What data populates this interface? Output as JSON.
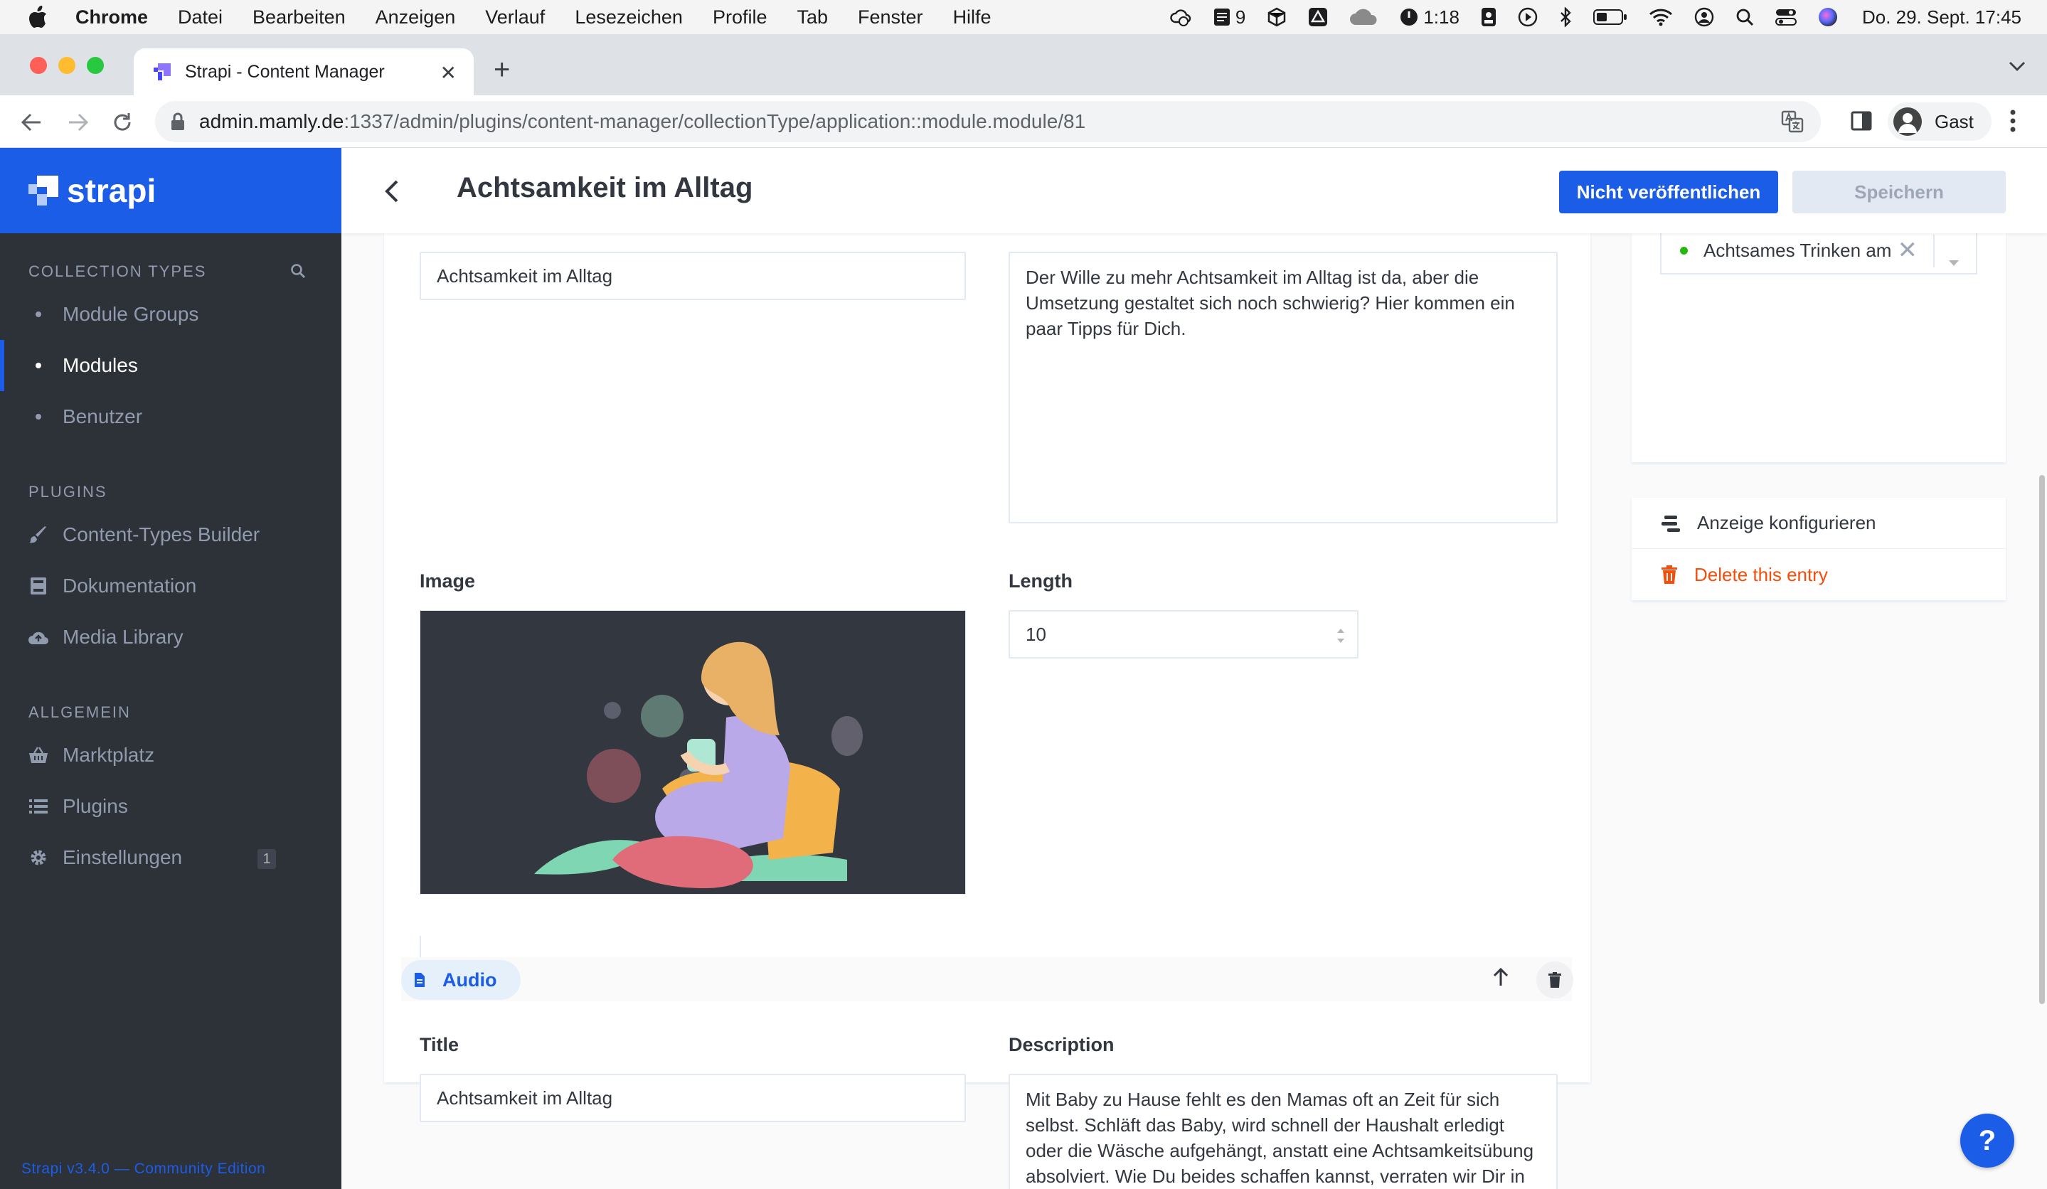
{
  "macos": {
    "app": "Chrome",
    "menu": [
      "Datei",
      "Bearbeiten",
      "Anzeigen",
      "Verlauf",
      "Lesezeichen",
      "Profile",
      "Tab",
      "Fenster",
      "Hilfe"
    ],
    "status_count": "9",
    "battery_time": "1:18",
    "clock": "Do. 29. Sept.  17:45"
  },
  "browser": {
    "tab_title": "Strapi - Content Manager",
    "url_host": "admin.mamly.de",
    "url_path": ":1337/admin/plugins/content-manager/collectionType/application::module.module/81",
    "profile": "Gast"
  },
  "sidebar": {
    "brand": "strapi",
    "collection_header": "COLLECTION TYPES",
    "collection_items": [
      {
        "label": "Module Groups"
      },
      {
        "label": "Modules"
      },
      {
        "label": "Benutzer"
      }
    ],
    "plugins_header": "PLUGINS",
    "plugins": [
      {
        "label": "Content-Types Builder",
        "icon": "paintbrush-icon"
      },
      {
        "label": "Dokumentation",
        "icon": "book-icon"
      },
      {
        "label": "Media Library",
        "icon": "cloud-upload-icon"
      }
    ],
    "general_header": "ALLGEMEIN",
    "general": [
      {
        "label": "Marktplatz",
        "icon": "basket-icon"
      },
      {
        "label": "Plugins",
        "icon": "list-icon"
      },
      {
        "label": "Einstellungen",
        "icon": "gear-icon",
        "badge": "1"
      }
    ],
    "footer": "Strapi v3.4.0 — Community Edition"
  },
  "header": {
    "title": "Achtsamkeit im Alltag",
    "publish_label": "Nicht veröffentlichen",
    "save_label": "Speichern"
  },
  "form": {
    "title_value": "Achtsamkeit im Alltag",
    "description_value": "Der Wille zu mehr Achtsamkeit im Alltag ist da, aber die Umsetzung gestaltet sich noch schwierig? Hier kommen ein paar Tipps für Dich.",
    "image_label": "Image",
    "length_label": "Length",
    "length_value": "10"
  },
  "component": {
    "name": "Audio",
    "title_label": "Title",
    "title_value": "Achtsamkeit im Alltag",
    "description_label": "Description",
    "description_value": "Mit Baby zu Hause fehlt es den Mamas oft an Zeit für sich selbst. Schläft das Baby, wird schnell der Haushalt erledigt oder die Wäsche aufgehängt, anstatt eine Achtsamkeitsübung absolviert. Wie Du beides schaffen kannst, verraten wir Dir in"
  },
  "right": {
    "relation_value": "Achtsames Trinken am",
    "configure_label": "Anzeige konfigurieren",
    "delete_label": "Delete this entry"
  },
  "help_label": "?",
  "colors": {
    "accent": "#1c5de7",
    "sidebar_bg": "#2d3138",
    "danger": "#f64d0a",
    "published_dot": "#27b70f"
  }
}
